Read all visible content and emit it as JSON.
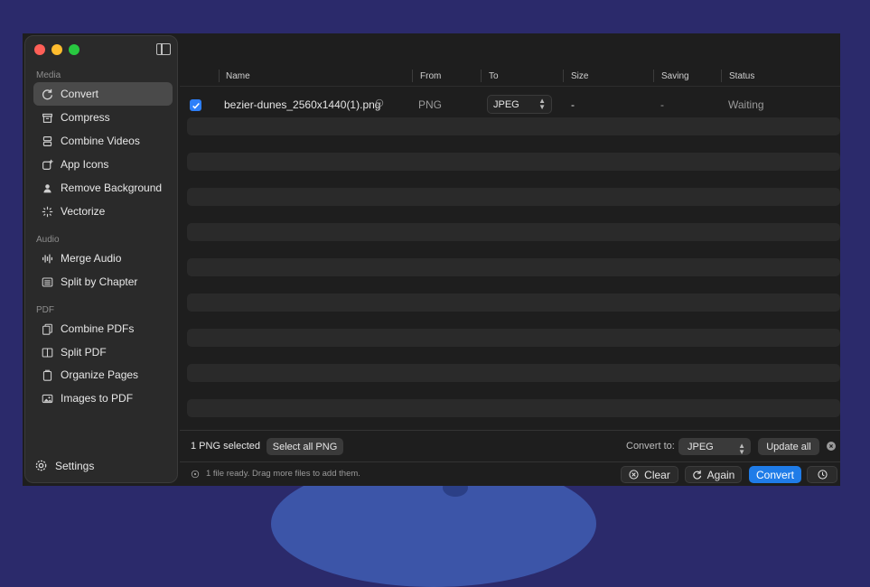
{
  "sidebar": {
    "sections": [
      {
        "label": "Media"
      },
      {
        "label": "Audio"
      },
      {
        "label": "PDF"
      }
    ],
    "items": [
      {
        "label": "Convert",
        "icon": "refresh-icon"
      },
      {
        "label": "Compress",
        "icon": "archive-icon"
      },
      {
        "label": "Combine Videos",
        "icon": "stack-icon"
      },
      {
        "label": "App Icons",
        "icon": "app-icon"
      },
      {
        "label": "Remove Background",
        "icon": "person-icon"
      },
      {
        "label": "Vectorize",
        "icon": "sparkle-icon"
      },
      {
        "label": "Merge Audio",
        "icon": "waveform-icon"
      },
      {
        "label": "Split by Chapter",
        "icon": "list-icon"
      },
      {
        "label": "Combine PDFs",
        "icon": "documents-icon"
      },
      {
        "label": "Split PDF",
        "icon": "split-icon"
      },
      {
        "label": "Organize Pages",
        "icon": "pages-icon"
      },
      {
        "label": "Images to PDF",
        "icon": "photos-icon"
      }
    ],
    "settings_label": "Settings"
  },
  "table": {
    "columns": [
      "Name",
      "From",
      "To",
      "Size",
      "Saving",
      "Status"
    ],
    "rows": [
      {
        "name": "bezier-dunes_2560x1440(1).png",
        "from": "PNG",
        "to": "JPEG",
        "size": "-",
        "saving": "-",
        "status": "Waiting",
        "checked": true
      }
    ]
  },
  "bottom_bar": {
    "selected_text": "1 PNG selected",
    "select_all_label": "Select all PNG",
    "convert_to_label": "Convert to:",
    "convert_to_value": "JPEG",
    "update_all_label": "Update all"
  },
  "status_bar": {
    "message": "1 file ready. Drag more files to add them.",
    "clear_label": "Clear",
    "again_label": "Again",
    "convert_label": "Convert"
  },
  "colors": {
    "accent": "#1f7ce8",
    "checkbox": "#2d7ff9"
  }
}
